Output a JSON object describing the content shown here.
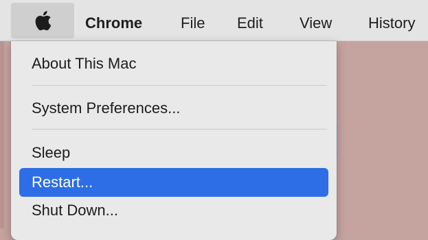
{
  "menubar": {
    "app_name": "Chrome",
    "items": [
      "File",
      "Edit",
      "View",
      "History"
    ]
  },
  "apple_menu": {
    "items": [
      {
        "label": "About This Mac"
      },
      {
        "label": "System Preferences..."
      },
      {
        "label": "Sleep"
      },
      {
        "label": "Restart...",
        "selected": true
      },
      {
        "label": "Shut Down..."
      }
    ]
  },
  "colors": {
    "desktop": "#c5a39f",
    "menubar": "#e4e4e4",
    "menu_background": "#e9e9e9",
    "selection": "#2d6ee7"
  },
  "icons": {
    "apple_menu": "apple-logo-icon"
  }
}
